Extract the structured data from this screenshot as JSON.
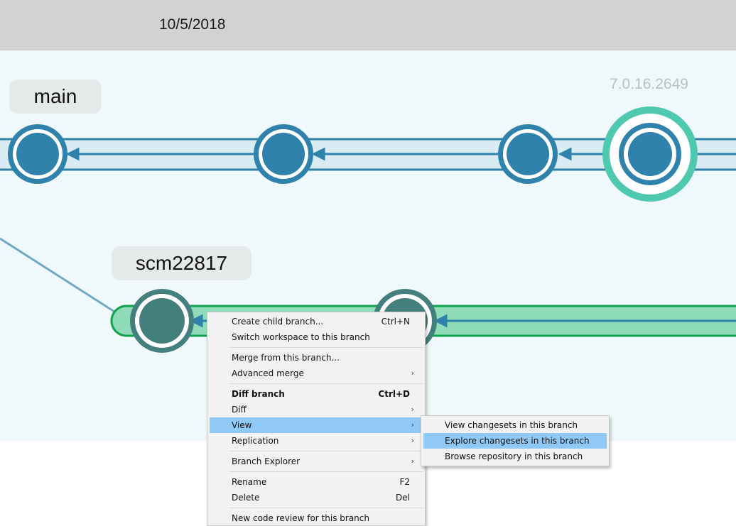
{
  "header": {
    "date": "10/5/2018"
  },
  "branches": {
    "main": {
      "label": "main"
    },
    "child": {
      "label": "scm22817"
    }
  },
  "label_tag": "7.0.16.2649",
  "colors": {
    "main_node": "#2e82ab",
    "main_band": "#d9ecf3",
    "child_node": "#437f7c",
    "child_band": "#8fdcb8",
    "label_ring": "#4ec9b0",
    "menu_highlight": "#90c8f6"
  },
  "context_menu": {
    "items": [
      {
        "label": "Create child branch...",
        "shortcut": "Ctrl+N"
      },
      {
        "label": "Switch workspace to this branch",
        "shortcut": ""
      },
      {
        "label": "Merge from this branch...",
        "shortcut": ""
      },
      {
        "label": "Advanced merge",
        "shortcut": "",
        "submenu": true
      },
      {
        "label": "Diff branch",
        "shortcut": "Ctrl+D",
        "bold": true
      },
      {
        "label": "Diff",
        "shortcut": "",
        "submenu": true
      },
      {
        "label": "View",
        "shortcut": "",
        "submenu": true,
        "highlighted": true
      },
      {
        "label": "Replication",
        "shortcut": "",
        "submenu": true
      },
      {
        "label": "Branch Explorer",
        "shortcut": "",
        "submenu": true
      },
      {
        "label": "Rename",
        "shortcut": "F2"
      },
      {
        "label": "Delete",
        "shortcut": "Del"
      },
      {
        "label": "New code review for this branch",
        "shortcut": ""
      }
    ]
  },
  "submenu": {
    "items": [
      {
        "label": "View changesets in this branch"
      },
      {
        "label": "Explore changesets in this branch",
        "highlighted": true
      },
      {
        "label": "Browse repository in this branch"
      }
    ]
  }
}
